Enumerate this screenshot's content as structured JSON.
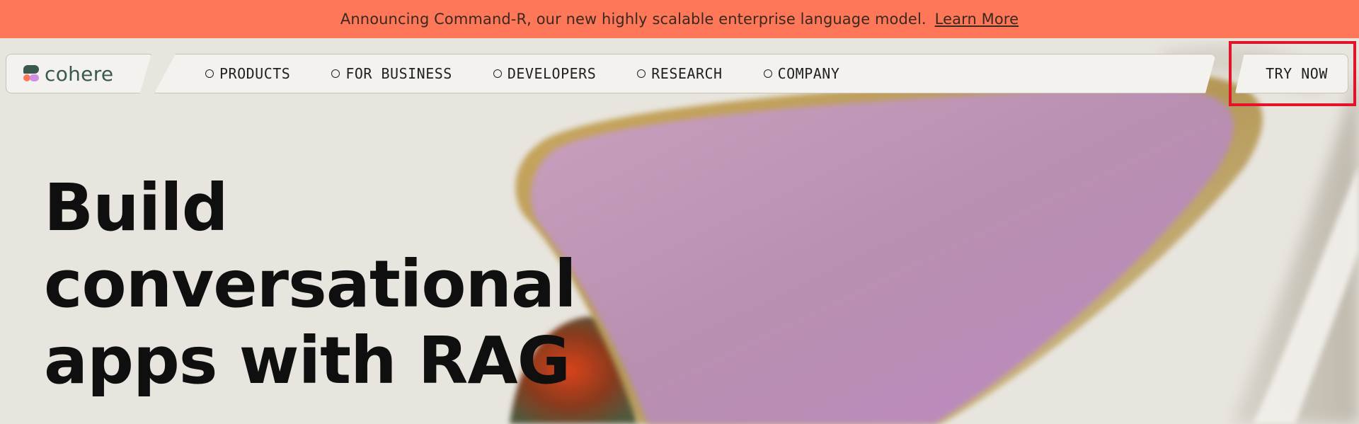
{
  "announcement": {
    "message": "Announcing Command-R, our new highly scalable enterprise language model.",
    "link_label": "Learn More"
  },
  "nav": {
    "logo_text": "cohere",
    "items": [
      {
        "label": "PRODUCTS"
      },
      {
        "label": "FOR BUSINESS"
      },
      {
        "label": "DEVELOPERS"
      },
      {
        "label": "RESEARCH"
      },
      {
        "label": "COMPANY"
      }
    ],
    "cta_label": "TRY NOW"
  },
  "hero": {
    "lines": [
      "Build",
      "conversational",
      "apps with RAG"
    ]
  },
  "colors": {
    "announce_bg": "#ff7759",
    "page_bg": "#e8e5df",
    "brand_green": "#39594d",
    "highlight": "#e3132a"
  }
}
